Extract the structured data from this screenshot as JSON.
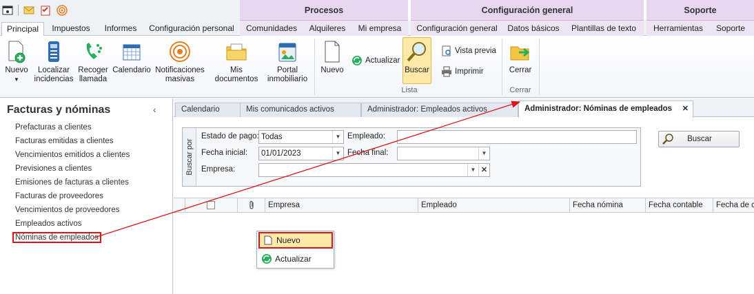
{
  "quick_access": {
    "icons": [
      "app-window-icon",
      "mail-icon",
      "checklist-icon",
      "broadcast-icon"
    ]
  },
  "context_groups": {
    "procesos": "Procesos",
    "configuracion": "Configuración general",
    "soporte": "Soporte"
  },
  "tabs": {
    "principal": "Principal",
    "impuestos": "Impuestos",
    "informes": "Informes",
    "config_personal": "Configuración personal",
    "comunidades": "Comunidades",
    "alquileres": "Alquileres",
    "mi_empresa": "Mi empresa",
    "config_general": "Configuración general",
    "datos_basicos": "Datos básicos",
    "plantillas": "Plantillas de texto",
    "herramientas": "Herramientas",
    "soporte": "Soporte"
  },
  "ribbon": {
    "nuevo": "Nuevo",
    "localizar_1": "Localizar",
    "localizar_2": "incidencias",
    "recoger_1": "Recoger",
    "recoger_2": "llamada",
    "calendario": "Calendario",
    "notif_1": "Notificaciones",
    "notif_2": "masivas",
    "mis_documentos": "Mis documentos",
    "portal_1": "Portal",
    "portal_2": "inmobiliario",
    "lista_nuevo": "Nuevo",
    "actualizar": "Actualizar",
    "buscar": "Buscar",
    "vista_previa": "Vista previa",
    "imprimir": "Imprimir",
    "group_lista": "Lista",
    "cerrar": "Cerrar",
    "group_cerrar": "Cerrar"
  },
  "leftnav": {
    "title": "Facturas y nóminas",
    "collapse": "‹",
    "items": [
      "Prefacturas a clientes",
      "Facturas emitidas a clientes",
      "Vencimientos emitidos a clientes",
      "Previsiones a clientes",
      "Emisiones de facturas a clientes",
      "Facturas de proveedores",
      "Vencimientos de proveedores",
      "Empleados activos",
      "Nóminas de empleados"
    ]
  },
  "doc_tabs": {
    "calendario": "Calendario",
    "comunicados": "Mis comunicados activos",
    "empleados": "Administrador: Empleados activos",
    "nominas": "Administrador: Nóminas de empleados",
    "close": "✕"
  },
  "search": {
    "panel_label": "Buscar por",
    "estado_label": "Estado de pago:",
    "estado_value": "Todas",
    "empleado_label": "Empleado:",
    "empleado_value": "",
    "fecha_inicial_label": "Fecha inicial:",
    "fecha_inicial_value": "01/01/2023",
    "fecha_final_label": "Fecha final:",
    "fecha_final_value": "",
    "empresa_label": "Empresa:",
    "empresa_value": "",
    "button": "Buscar"
  },
  "grid": {
    "columns": [
      "Empresa",
      "Empleado",
      "Fecha nómina",
      "Fecha contable",
      "Fecha de cre"
    ]
  },
  "context_menu": {
    "nuevo": "Nuevo",
    "actualizar": "Actualizar"
  },
  "colors": {
    "highlight_red": "#d9151a",
    "pressed_yellow": "#fde9a8",
    "context_purple": "#e6d6ee"
  }
}
